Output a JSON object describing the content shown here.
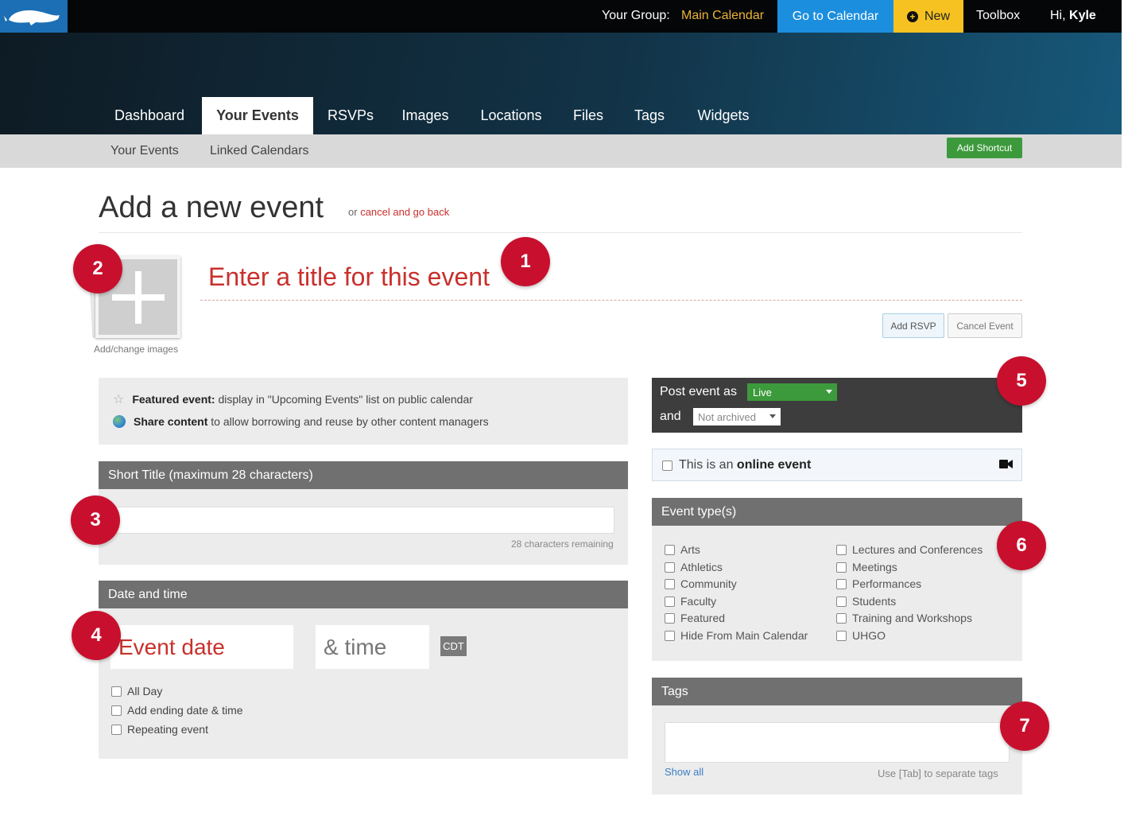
{
  "topbar": {
    "group_label": "Your Group:",
    "group_value": "Main Calendar",
    "go_to_calendar": "Go to Calendar",
    "new_label": "New",
    "toolbox": "Toolbox",
    "greeting": "Hi,",
    "user_name": "Kyle"
  },
  "tabs": [
    {
      "label": "Dashboard"
    },
    {
      "label": "Your Events"
    },
    {
      "label": "RSVPs"
    },
    {
      "label": "Images"
    },
    {
      "label": "Locations"
    },
    {
      "label": "Files"
    },
    {
      "label": "Tags"
    },
    {
      "label": "Widgets"
    }
  ],
  "active_tab": "Your Events",
  "subnav": {
    "items": [
      "Your Events",
      "Linked Calendars"
    ],
    "add_shortcut": "Add Shortcut"
  },
  "page": {
    "title": "Add a new event",
    "cancel_prefix": "or",
    "cancel_link": "cancel and go back"
  },
  "event": {
    "title_placeholder": "Enter a title for this event",
    "image_label": "Add/change images",
    "add_rsvp": "Add RSVP",
    "cancel_event": "Cancel Event"
  },
  "badges": [
    "1",
    "2",
    "3",
    "4",
    "5",
    "6",
    "7"
  ],
  "featured": {
    "featured_label": "Featured event:",
    "featured_desc": "display in \"Upcoming Events\" list on public calendar",
    "share_label": "Share content",
    "share_desc": "to allow borrowing and reuse by other content managers"
  },
  "short_title": {
    "header": "Short Title (maximum 28 characters)",
    "remaining": "28 characters remaining"
  },
  "date_time": {
    "header": "Date and time",
    "date_placeholder": "Event date",
    "time_placeholder": "& time",
    "timezone": "CDT",
    "options": [
      "All Day",
      "Add ending date & time",
      "Repeating event"
    ]
  },
  "status": {
    "post_as_label": "Post event as",
    "post_as_value": "Live",
    "and_label": "and",
    "archive_value": "Not archived"
  },
  "online": {
    "prefix": "This is an",
    "bold": "online event"
  },
  "event_types": {
    "header": "Event type(s)",
    "column1": [
      "Arts",
      "Athletics",
      "Community",
      "Faculty",
      "Featured",
      "Hide From Main Calendar"
    ],
    "column2": [
      "Lectures and Conferences",
      "Meetings",
      "Performances",
      "Students",
      "Training and Workshops",
      "UHGO"
    ]
  },
  "tags": {
    "header": "Tags",
    "show_all": "Show all",
    "hint": "Use [Tab] to separate tags"
  },
  "colors": {
    "accent_red": "#c8102e",
    "calendar_blue": "#1b8ede",
    "new_yellow": "#f6c222",
    "live_green": "#3c9a3c"
  }
}
